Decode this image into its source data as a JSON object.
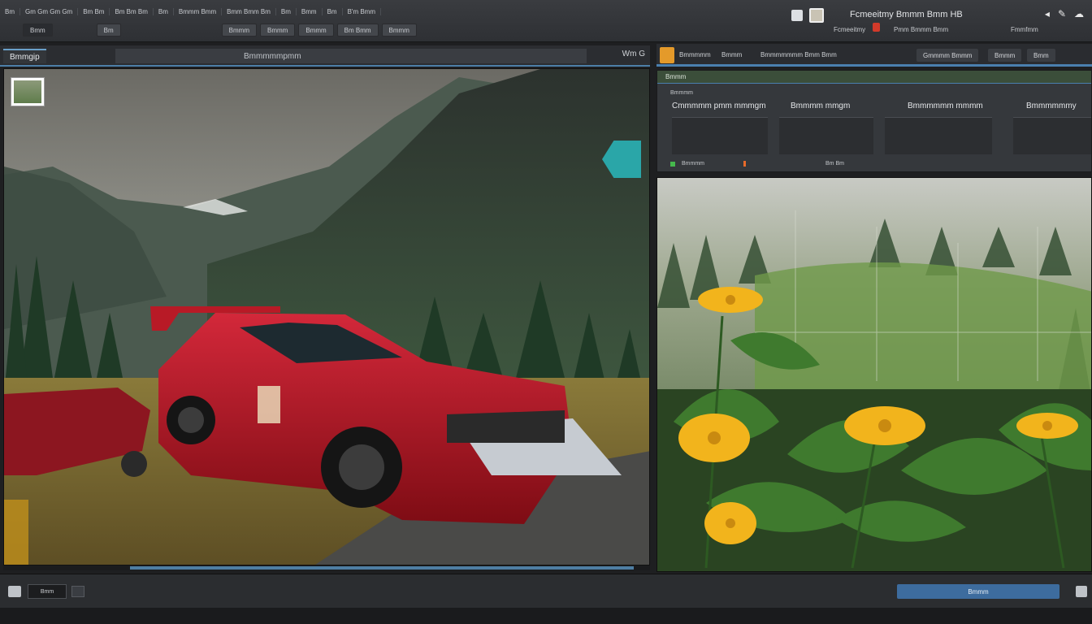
{
  "menu": {
    "items": [
      "Bm",
      "Gm Gm Gm Gm",
      "Bm Bm",
      "Bm Bm Bm",
      "Bm",
      "Bmmm Bmm",
      "Bmm Bmm Bm",
      "Bm",
      "Bmm",
      "Bm",
      "B'm Bmm"
    ]
  },
  "toolbar": {
    "buttons": [
      "Bmm",
      "Bm",
      "Bmmm",
      "Bmmm",
      "Bmmm",
      "Bm Bmm",
      "Bmmm"
    ]
  },
  "header": {
    "app_title": "Fcmeeitmy Bmmm Bmm HB",
    "sub_left": "Fcmeeitmy",
    "sub_mid": "Pmm Bmmm Bmm",
    "sub_right": "Fmmfmm"
  },
  "left_tabs": {
    "active_label": "Bmmgip",
    "mid_label": "Bmmmmmpmm",
    "corner": "Wm G"
  },
  "right_header": {
    "label_1": "Bmmmmm",
    "label_2": "Bmmm",
    "label_3": "Bmmmmmmm Bmm Bmm",
    "button_1": "Gmmmm Bmmm",
    "button_2": "Bmmm",
    "button_3": "Bmm"
  },
  "stats": {
    "header": "Bmmm",
    "label": "Bmmmm",
    "columns": [
      {
        "title": "Cmmmmm pmm mmmgm"
      },
      {
        "title": "Bmmmm mmgm"
      },
      {
        "title": "Bmmmmmm mmmm"
      },
      {
        "title": "Bmmmmmmy"
      }
    ],
    "footer_1": "Bmmmm",
    "footer_2": "Bm Bm"
  },
  "statusbar": {
    "field": "Bmm",
    "button": "Bmmm"
  },
  "colors": {
    "accent": "#4a7fae",
    "teal": "#2aa6a8",
    "orange": "#e49a2a",
    "red_car": "#b0121c",
    "flower": "#f2b41c"
  },
  "icons": {
    "teal_marker": "layer-marker-icon",
    "orange_badge": "panel-badge-icon"
  }
}
